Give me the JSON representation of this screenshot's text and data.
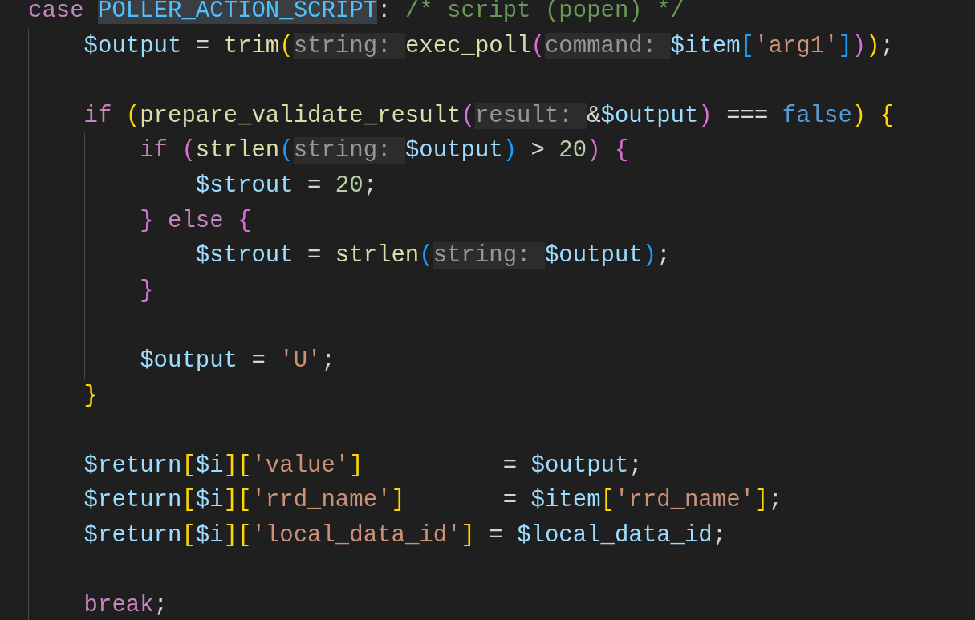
{
  "editor": {
    "lines": [
      {
        "kind": "code",
        "tokens": [
          {
            "kind": "kw",
            "text": "case "
          },
          {
            "kind": "match",
            "text": "POLLER_ACTION_SCRIPT"
          },
          {
            "kind": "punct",
            "text": ": "
          },
          {
            "kind": "comment",
            "text": "/* script (popen) */"
          }
        ],
        "children": [
          {
            "kind": "code",
            "tokens": [
              {
                "kind": "var",
                "text": "$output"
              },
              {
                "kind": "punct",
                "text": " = "
              },
              {
                "kind": "fn",
                "text": "trim"
              },
              {
                "kind": "b1",
                "text": "("
              },
              {
                "kind": "hint",
                "text": "string: "
              },
              {
                "kind": "fn",
                "text": "exec_poll"
              },
              {
                "kind": "b2",
                "text": "("
              },
              {
                "kind": "hint",
                "text": "command: "
              },
              {
                "kind": "var",
                "text": "$item"
              },
              {
                "kind": "b3",
                "text": "["
              },
              {
                "kind": "str",
                "text": "'arg1'"
              },
              {
                "kind": "b3",
                "text": "]"
              },
              {
                "kind": "b2",
                "text": ")"
              },
              {
                "kind": "b1",
                "text": ")"
              },
              {
                "kind": "punct",
                "text": ";"
              }
            ]
          },
          {
            "kind": "blank"
          },
          {
            "kind": "code",
            "tokens": [
              {
                "kind": "kw",
                "text": "if "
              },
              {
                "kind": "b1",
                "text": "("
              },
              {
                "kind": "fn",
                "text": "prepare_validate_result"
              },
              {
                "kind": "b2",
                "text": "("
              },
              {
                "kind": "hint",
                "text": "result: "
              },
              {
                "kind": "punct",
                "text": "&"
              },
              {
                "kind": "var",
                "text": "$output"
              },
              {
                "kind": "b2",
                "text": ")"
              },
              {
                "kind": "punct",
                "text": " === "
              },
              {
                "kind": "bool",
                "text": "false"
              },
              {
                "kind": "b1",
                "text": ") "
              },
              {
                "kind": "b1",
                "text": "{"
              }
            ],
            "children": [
              {
                "kind": "code",
                "tokens": [
                  {
                    "kind": "kw",
                    "text": "if "
                  },
                  {
                    "kind": "b2",
                    "text": "("
                  },
                  {
                    "kind": "fn",
                    "text": "strlen"
                  },
                  {
                    "kind": "b3",
                    "text": "("
                  },
                  {
                    "kind": "hint",
                    "text": "string: "
                  },
                  {
                    "kind": "var",
                    "text": "$output"
                  },
                  {
                    "kind": "b3",
                    "text": ")"
                  },
                  {
                    "kind": "punct",
                    "text": " > "
                  },
                  {
                    "kind": "num",
                    "text": "20"
                  },
                  {
                    "kind": "b2",
                    "text": ") "
                  },
                  {
                    "kind": "b2",
                    "text": "{"
                  }
                ],
                "children": [
                  {
                    "kind": "code",
                    "tokens": [
                      {
                        "kind": "var",
                        "text": "$strout"
                      },
                      {
                        "kind": "punct",
                        "text": " = "
                      },
                      {
                        "kind": "num",
                        "text": "20"
                      },
                      {
                        "kind": "punct",
                        "text": ";"
                      }
                    ]
                  }
                ]
              },
              {
                "kind": "code",
                "tokens": [
                  {
                    "kind": "b2",
                    "text": "} "
                  },
                  {
                    "kind": "kw",
                    "text": "else "
                  },
                  {
                    "kind": "b2",
                    "text": "{"
                  }
                ],
                "children": [
                  {
                    "kind": "code",
                    "tokens": [
                      {
                        "kind": "var",
                        "text": "$strout"
                      },
                      {
                        "kind": "punct",
                        "text": " = "
                      },
                      {
                        "kind": "fn",
                        "text": "strlen"
                      },
                      {
                        "kind": "b3",
                        "text": "("
                      },
                      {
                        "kind": "hint",
                        "text": "string: "
                      },
                      {
                        "kind": "var",
                        "text": "$output"
                      },
                      {
                        "kind": "b3",
                        "text": ")"
                      },
                      {
                        "kind": "punct",
                        "text": ";"
                      }
                    ]
                  }
                ]
              },
              {
                "kind": "code",
                "tokens": [
                  {
                    "kind": "b2",
                    "text": "}"
                  }
                ]
              },
              {
                "kind": "blank"
              },
              {
                "kind": "code",
                "tokens": [
                  {
                    "kind": "var",
                    "text": "$output"
                  },
                  {
                    "kind": "punct",
                    "text": " = "
                  },
                  {
                    "kind": "str",
                    "text": "'U'"
                  },
                  {
                    "kind": "punct",
                    "text": ";"
                  }
                ]
              }
            ]
          },
          {
            "kind": "code",
            "tokens": [
              {
                "kind": "b1",
                "text": "}"
              }
            ]
          },
          {
            "kind": "blank"
          },
          {
            "kind": "code",
            "tokens": [
              {
                "kind": "var",
                "text": "$return"
              },
              {
                "kind": "b1",
                "text": "["
              },
              {
                "kind": "var",
                "text": "$i"
              },
              {
                "kind": "b1",
                "text": "]"
              },
              {
                "kind": "b1",
                "text": "["
              },
              {
                "kind": "str",
                "text": "'value'"
              },
              {
                "kind": "b1",
                "text": "]"
              },
              {
                "kind": "punct",
                "text": "          = "
              },
              {
                "kind": "var",
                "text": "$output"
              },
              {
                "kind": "punct",
                "text": ";"
              }
            ]
          },
          {
            "kind": "code",
            "tokens": [
              {
                "kind": "var",
                "text": "$return"
              },
              {
                "kind": "b1",
                "text": "["
              },
              {
                "kind": "var",
                "text": "$i"
              },
              {
                "kind": "b1",
                "text": "]"
              },
              {
                "kind": "b1",
                "text": "["
              },
              {
                "kind": "str",
                "text": "'rrd_name'"
              },
              {
                "kind": "b1",
                "text": "]"
              },
              {
                "kind": "punct",
                "text": "       = "
              },
              {
                "kind": "var",
                "text": "$item"
              },
              {
                "kind": "b1",
                "text": "["
              },
              {
                "kind": "str",
                "text": "'rrd_name'"
              },
              {
                "kind": "b1",
                "text": "]"
              },
              {
                "kind": "punct",
                "text": ";"
              }
            ]
          },
          {
            "kind": "code",
            "tokens": [
              {
                "kind": "var",
                "text": "$return"
              },
              {
                "kind": "b1",
                "text": "["
              },
              {
                "kind": "var",
                "text": "$i"
              },
              {
                "kind": "b1",
                "text": "]"
              },
              {
                "kind": "b1",
                "text": "["
              },
              {
                "kind": "str",
                "text": "'local_data_id'"
              },
              {
                "kind": "b1",
                "text": "]"
              },
              {
                "kind": "punct",
                "text": " = "
              },
              {
                "kind": "var",
                "text": "$local_data_id"
              },
              {
                "kind": "punct",
                "text": ";"
              }
            ]
          },
          {
            "kind": "blank"
          },
          {
            "kind": "code",
            "tokens": [
              {
                "kind": "kw",
                "text": "break"
              },
              {
                "kind": "punct",
                "text": ";"
              }
            ]
          }
        ]
      }
    ]
  }
}
